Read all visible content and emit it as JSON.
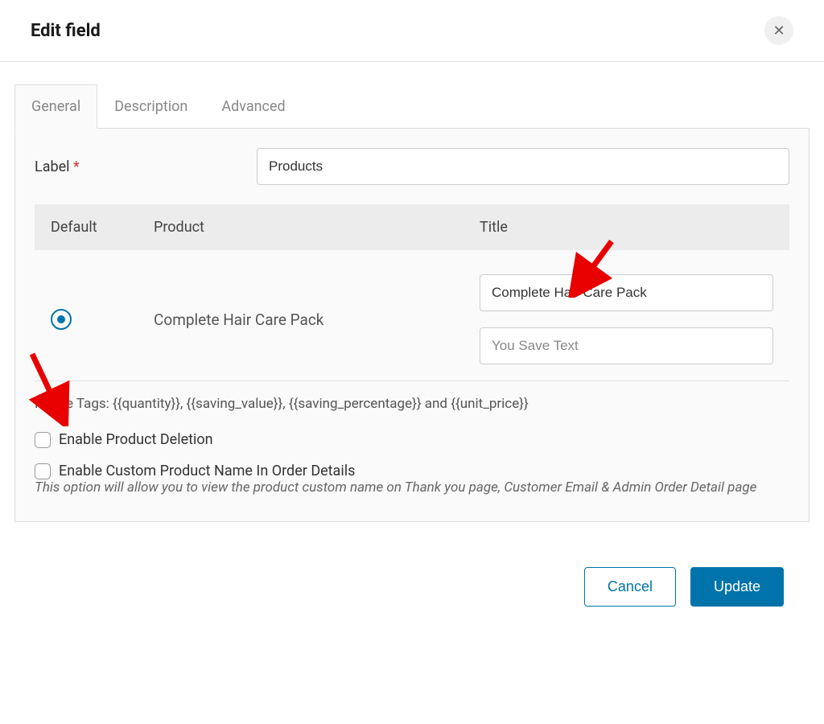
{
  "modalTitle": "Edit field",
  "tabs": {
    "general": "General",
    "description": "Description",
    "advanced": "Advanced"
  },
  "form": {
    "labelFieldLabel": "Label",
    "labelFieldValue": "Products"
  },
  "table": {
    "headers": {
      "default": "Default",
      "product": "Product",
      "title": "Title"
    },
    "row": {
      "productName": "Complete Hair Care Pack",
      "titleValue": "Complete Hair Care Pack",
      "youSavePlaceholder": "You Save Text"
    }
  },
  "mergeTagsText": "Merge Tags: {{quantity}}, {{saving_value}}, {{saving_percentage}} and {{unit_price}}",
  "checkboxes": {
    "enableDeletion": "Enable Product Deletion",
    "enableCustomName": "Enable Custom Product Name In Order Details",
    "customNameHelp": "This option will allow you to view the product custom name on Thank you page, Customer Email & Admin Order Detail page"
  },
  "buttons": {
    "cancel": "Cancel",
    "update": "Update"
  }
}
